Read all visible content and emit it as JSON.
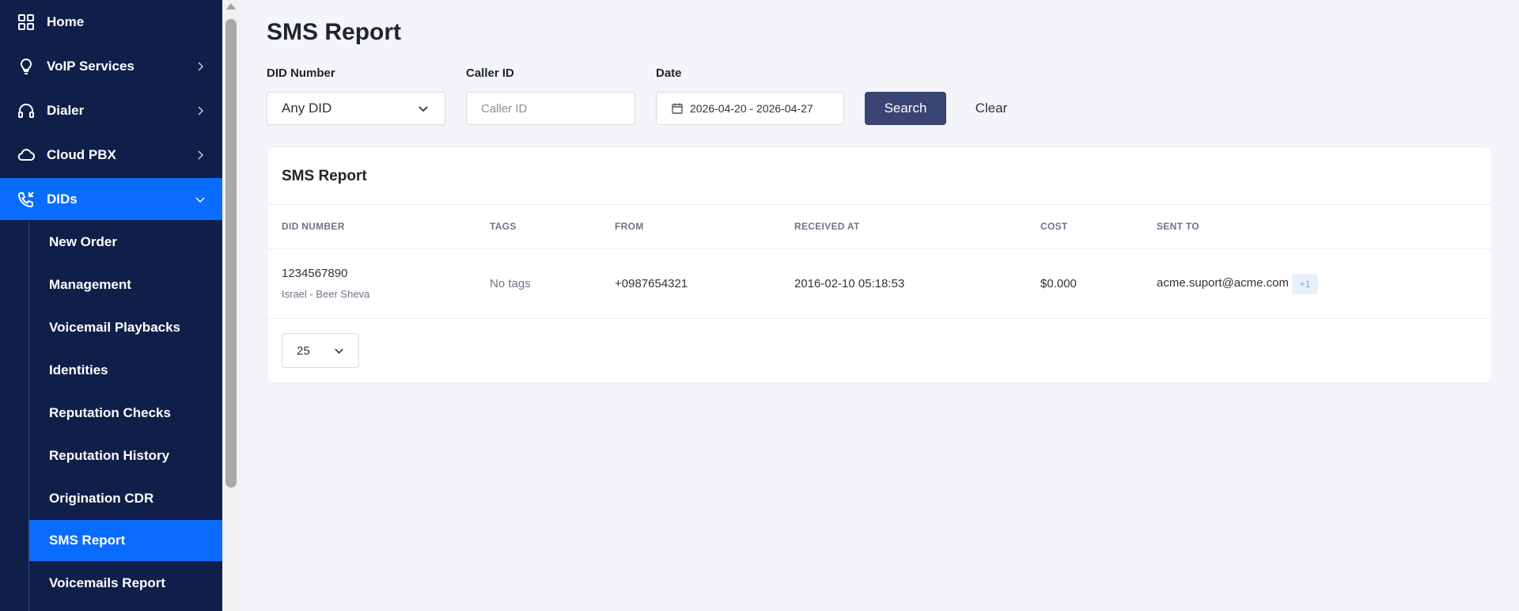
{
  "sidebar": {
    "items": [
      {
        "label": "Home",
        "icon": "grid-icon"
      },
      {
        "label": "VoIP Services",
        "icon": "lightbulb-icon"
      },
      {
        "label": "Dialer",
        "icon": "headset-icon"
      },
      {
        "label": "Cloud PBX",
        "icon": "cloud-phone-icon"
      },
      {
        "label": "DIDs",
        "icon": "phone-incoming-icon"
      }
    ],
    "sub_items": [
      {
        "label": "New Order"
      },
      {
        "label": "Management"
      },
      {
        "label": "Voicemail Playbacks"
      },
      {
        "label": "Identities"
      },
      {
        "label": "Reputation Checks"
      },
      {
        "label": "Reputation History"
      },
      {
        "label": "Origination CDR"
      },
      {
        "label": "SMS Report"
      },
      {
        "label": "Voicemails Report"
      }
    ],
    "active_item": "DIDs",
    "active_sub_item": "SMS Report"
  },
  "page": {
    "title": "SMS Report"
  },
  "filters": {
    "did_label": "DID Number",
    "did_value": "Any DID",
    "caller_label": "Caller ID",
    "caller_placeholder": "Caller ID",
    "date_label": "Date",
    "date_value": "2026-04-20 - 2026-04-27",
    "search_label": "Search",
    "clear_label": "Clear"
  },
  "report": {
    "title": "SMS Report",
    "columns": [
      "DID NUMBER",
      "TAGS",
      "FROM",
      "RECEIVED AT",
      "COST",
      "SENT TO"
    ],
    "rows": [
      {
        "did": "1234567890",
        "location": "Israel - Beer Sheva",
        "tags": "No tags",
        "from": "+0987654321",
        "received_at": "2016-02-10 05:18:53",
        "cost": "$0.000",
        "sent_to": "acme.suport@acme.com",
        "extra": "+1"
      }
    ],
    "page_size": "25"
  },
  "colors": {
    "sidebar_bg": "#0f1f4a",
    "active": "#0a6cff",
    "primary_button": "#3b4573",
    "page_bg": "#f4f5f9"
  }
}
